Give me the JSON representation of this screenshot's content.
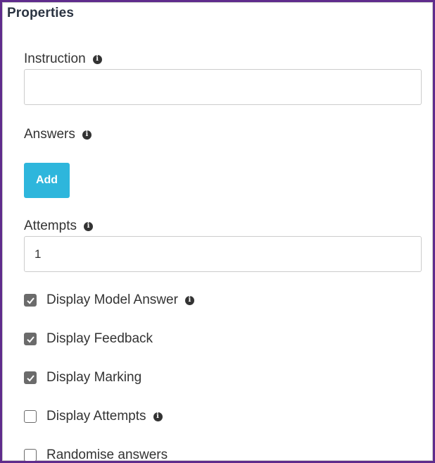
{
  "panel": {
    "title": "Properties"
  },
  "instruction": {
    "label": "Instruction",
    "info_icon": "info-circle-icon",
    "value": "",
    "placeholder": ""
  },
  "answers": {
    "label": "Answers",
    "info_icon": "info-circle-icon",
    "add_label": "Add"
  },
  "attempts": {
    "label": "Attempts",
    "info_icon": "info-circle-icon",
    "value": "1"
  },
  "options": [
    {
      "label": "Display Model Answer",
      "checked": true,
      "has_info": true
    },
    {
      "label": "Display Feedback",
      "checked": true,
      "has_info": false
    },
    {
      "label": "Display Marking",
      "checked": true,
      "has_info": false
    },
    {
      "label": "Display Attempts",
      "checked": false,
      "has_info": true
    },
    {
      "label": "Randomise answers",
      "checked": false,
      "has_info": false
    }
  ],
  "colors": {
    "frame_border": "#5f2b8c",
    "add_button": "#2eb6dc",
    "checkbox": "#6b6b6b",
    "text": "#333333"
  }
}
